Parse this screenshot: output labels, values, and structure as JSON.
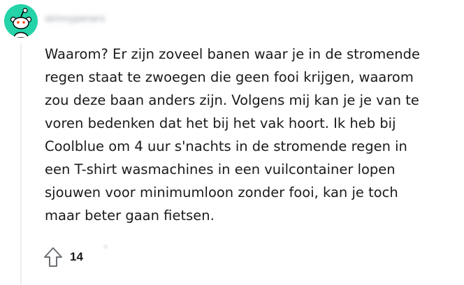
{
  "comment": {
    "author_blurred": "skinnypeners",
    "avatar_icon": "reddit-snoo-icon",
    "avatar_color": "#24d3a8",
    "body_lines": [
      "Waarom? Er zijn zoveel banen waar je in de stromende",
      "regen staat te zwoegen die geen fooi krijgen, waarom",
      "zou deze baan anders zijn. Volgens mij kan je je van te",
      "voren bedenken dat het bij het vak hoort. Ik heb bij",
      "Coolblue om 4 uur s'nachts in de stromende regen in",
      "een T-shirt wasmachines in een vuilcontainer lopen",
      "sjouwen voor minimumloon zonder fooi, kan je toch",
      "maar beter gaan fietsen."
    ],
    "upvote_icon": "upvote-arrow-icon",
    "score": "14"
  }
}
